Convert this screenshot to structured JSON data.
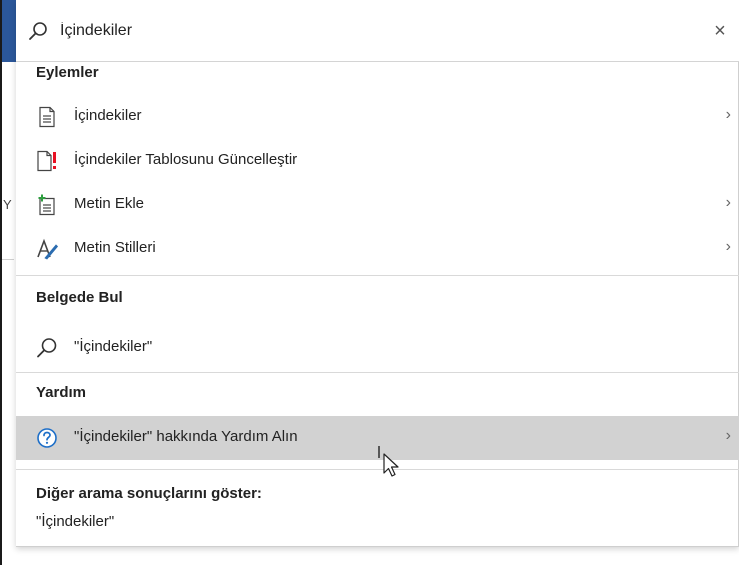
{
  "search": {
    "value": "İçindekiler",
    "clear_icon": "×"
  },
  "sections": {
    "actions_title": "Eylemler",
    "find_title": "Belgede Bul",
    "help_title": "Yardım"
  },
  "actions": [
    {
      "label": "İçindekiler",
      "icon": "toc-icon",
      "has_submenu": true
    },
    {
      "label": "İçindekiler Tablosunu Güncelleştir",
      "icon": "toc-update-icon",
      "has_submenu": false
    },
    {
      "label": "Metin Ekle",
      "icon": "add-text-icon",
      "has_submenu": true
    },
    {
      "label": "Metin Stilleri",
      "icon": "text-styles-icon",
      "has_submenu": true
    }
  ],
  "find": {
    "label": "\"İçindekiler\"",
    "icon": "search-icon"
  },
  "help": {
    "label": "\"İçindekiler\" hakkında Yardım Alın",
    "icon": "help-icon",
    "has_submenu": true
  },
  "more_results": {
    "title": "Diğer arama sonuçlarını göster:",
    "query": "\"İçindekiler\""
  },
  "chevron": "›",
  "background": {
    "stray_letter": "Y"
  },
  "colors": {
    "ribbon_blue": "#2b579a",
    "hover_gray": "#d2d2d2",
    "help_blue": "#1e6fc8",
    "update_red": "#e81123",
    "add_green": "#2e9e3f"
  }
}
